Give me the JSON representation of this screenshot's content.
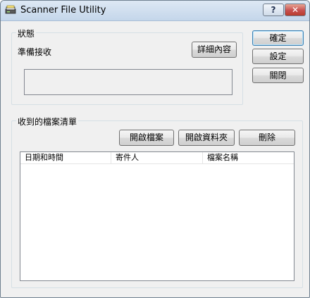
{
  "window": {
    "title": "Scanner File Utility",
    "help_label": "?",
    "close_label": "✕"
  },
  "status_group": {
    "label": "狀態",
    "status_text": "準備接收",
    "details_button": "詳細內容",
    "status_detail_value": ""
  },
  "actions": {
    "ok": "確定",
    "settings": "設定",
    "close": "關閉"
  },
  "received_group": {
    "label": "收到的檔案清單",
    "open_file": "開啟檔案",
    "open_folder": "開啟資料夾",
    "delete": "刪除",
    "columns": [
      "日期和時間",
      "寄件人",
      "檔案名稱"
    ],
    "rows": []
  },
  "colors": {
    "window_bg": "#f0f0f0",
    "title_gradient_top": "#dde8f4",
    "close_button": "#c75050"
  },
  "icons": {
    "app": "scanner-icon",
    "help": "help-icon",
    "close": "close-icon"
  }
}
